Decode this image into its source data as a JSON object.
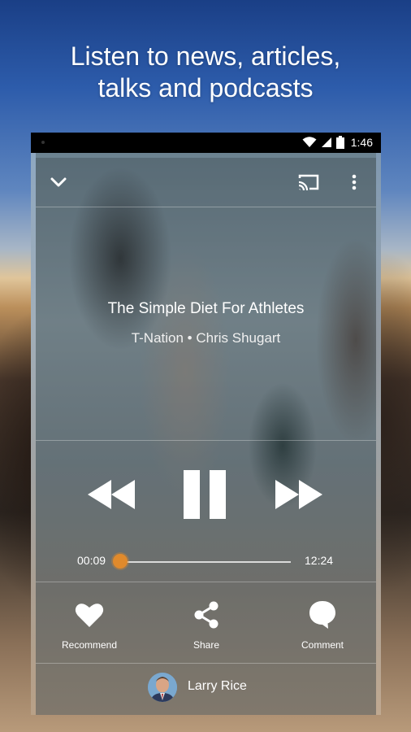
{
  "promo": {
    "line1": "Listen to news, articles,",
    "line2": "talks and podcasts"
  },
  "status_bar": {
    "time": "1:46",
    "icons": [
      "wifi-icon",
      "signal-icon",
      "battery-icon"
    ]
  },
  "toolbar": {
    "icons": [
      "chevron-down-icon",
      "cast-icon",
      "more-vert-icon"
    ]
  },
  "now_playing": {
    "title": "The Simple Diet For Athletes",
    "subtitle": "T-Nation • Chris Shugart"
  },
  "player": {
    "current_time": "00:09",
    "duration": "12:24",
    "progress": 0.012,
    "state": "playing",
    "accent": "#e08a2c"
  },
  "actions": {
    "recommend": "Recommend",
    "share": "Share",
    "comment": "Comment"
  },
  "author": {
    "name": "Larry Rice"
  }
}
